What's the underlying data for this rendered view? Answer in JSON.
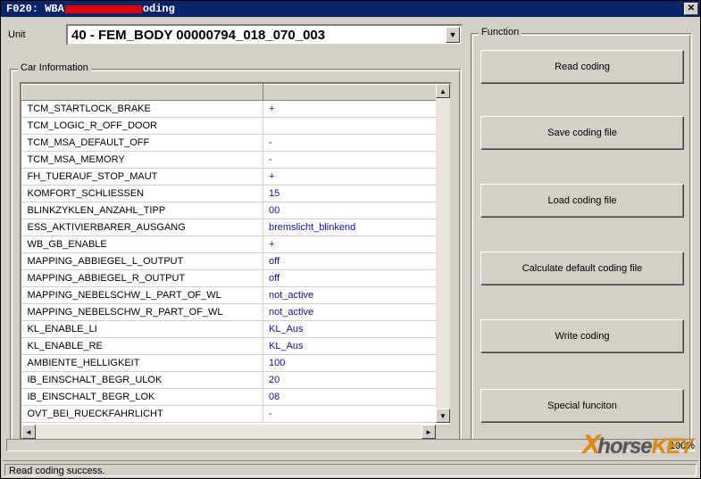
{
  "title": {
    "prefix": "F020: WBA",
    "suffix": "oding"
  },
  "unit": {
    "label": "Unit",
    "value": "40 - FEM_BODY   00000794_018_070_003"
  },
  "carinfo": {
    "legend": "Car Information",
    "rows": [
      {
        "name": "TCM_STARTLOCK_BRAKE",
        "value": "+"
      },
      {
        "name": "TCM_LOGIC_R_OFF_DOOR",
        "value": ""
      },
      {
        "name": "TCM_MSA_DEFAULT_OFF",
        "value": "-"
      },
      {
        "name": "TCM_MSA_MEMORY",
        "value": "-"
      },
      {
        "name": "FH_TUERAUF_STOP_MAUT",
        "value": "+"
      },
      {
        "name": "KOMFORT_SCHLIESSEN",
        "value": "15"
      },
      {
        "name": "BLINKZYKLEN_ANZAHL_TIPP",
        "value": "00"
      },
      {
        "name": "ESS_AKTIVIERBARER_AUSGANG",
        "value": "bremslicht_blinkend"
      },
      {
        "name": "WB_GB_ENABLE",
        "value": "+"
      },
      {
        "name": "MAPPING_ABBIEGEL_L_OUTPUT",
        "value": "off"
      },
      {
        "name": "MAPPING_ABBIEGEL_R_OUTPUT",
        "value": "off"
      },
      {
        "name": "MAPPING_NEBELSCHW_L_PART_OF_WL",
        "value": "not_active"
      },
      {
        "name": "MAPPING_NEBELSCHW_R_PART_OF_WL",
        "value": "not_active"
      },
      {
        "name": "KL_ENABLE_LI",
        "value": "KL_Aus"
      },
      {
        "name": "KL_ENABLE_RE",
        "value": "KL_Aus"
      },
      {
        "name": "AMBIENTE_HELLIGKEIT",
        "value": "100"
      },
      {
        "name": "IB_EINSCHALT_BEGR_ULOK",
        "value": "20"
      },
      {
        "name": "IB_EINSCHALT_BEGR_LOK",
        "value": "08"
      },
      {
        "name": "OVT_BEI_RUECKFAHRLICHT",
        "value": "-"
      }
    ]
  },
  "function": {
    "legend": "Function",
    "buttons": [
      "Read coding",
      "Save coding file",
      "Load coding file",
      "Calculate default coding file",
      "Write coding",
      "Special funciton"
    ]
  },
  "progress": "100%",
  "status": "Read coding success.",
  "watermark": {
    "x": "X",
    "body": "horse",
    "k": "KEY"
  }
}
